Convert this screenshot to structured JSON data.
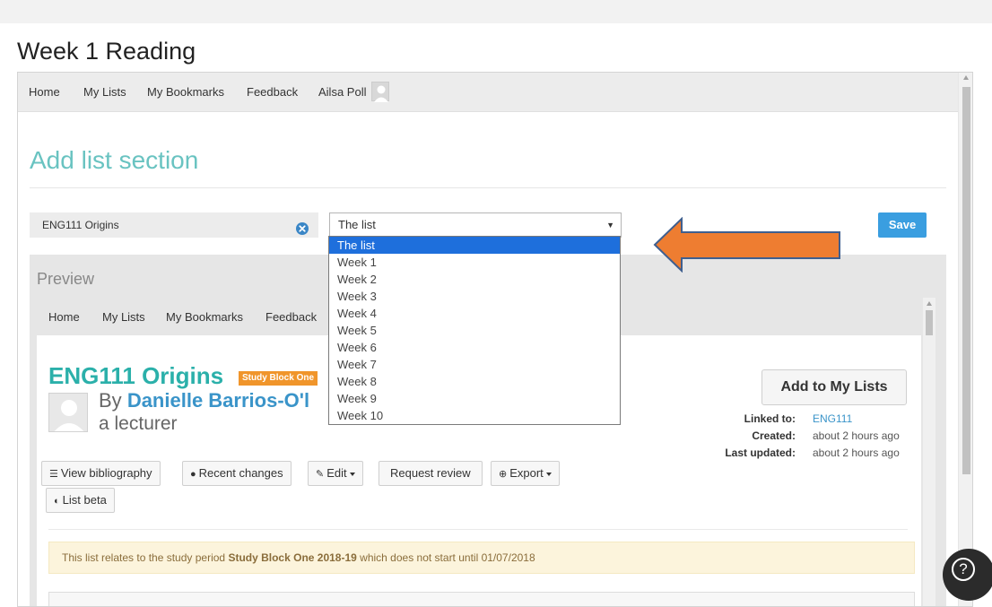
{
  "page": {
    "title": "Week 1 Reading"
  },
  "nav": {
    "items": [
      "Home",
      "My Lists",
      "My Bookmarks",
      "Feedback"
    ],
    "user": "Ailsa Poll"
  },
  "form": {
    "heading": "Add list section",
    "section_name_value": "ENG111 Origins",
    "select_value": "The list",
    "save_label": "Save"
  },
  "dropdown": {
    "options": [
      "The list",
      "Week 1",
      "Week 2",
      "Week 3",
      "Week 4",
      "Week 5",
      "Week 6",
      "Week 7",
      "Week 8",
      "Week 9",
      "Week 10"
    ],
    "selected_index": 0
  },
  "preview": {
    "label": "Preview",
    "nav": [
      "Home",
      "My Lists",
      "My Bookmarks",
      "Feedback"
    ],
    "list_title": "ENG111 Origins",
    "badge": "Study Block One",
    "by": "By",
    "author": "Danielle Barrios-O'l",
    "role": "a lecturer",
    "add_button": "Add to My Lists",
    "meta": {
      "linked_label": "Linked to:",
      "linked_value": "ENG111",
      "created_label": "Created:",
      "created_value": "about 2 hours ago",
      "updated_label": "Last updated:",
      "updated_value": "about 2 hours ago"
    },
    "buttons": {
      "bibliography": "View bibliography",
      "recent": "Recent changes",
      "edit": "Edit",
      "review": "Request review",
      "export": "Export",
      "beta": "List beta"
    },
    "notice": {
      "prefix": "This list relates to the study period",
      "period": "Study Block One 2018-19",
      "suffix": "which does not start until 01/07/2018"
    }
  },
  "colors": {
    "accent_teal": "#69c3c1",
    "title_teal": "#2bb0aa",
    "save_blue": "#3a9ee0",
    "badge_orange": "#f0952b",
    "callout_arrow": "#ee7d31",
    "dropdown_highlight": "#1e6fdc"
  },
  "icons": {
    "clear": "circle-x-icon",
    "help": "question-icon",
    "callout": "left-arrow-icon"
  }
}
